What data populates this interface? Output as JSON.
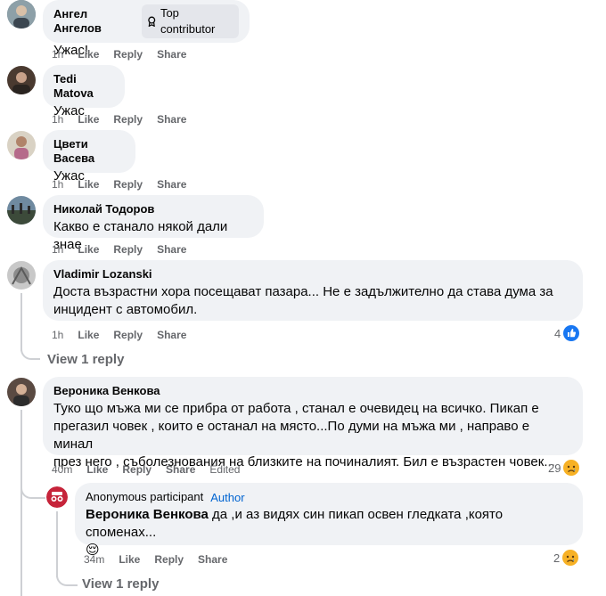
{
  "comments": [
    {
      "author": "Ангел Ангелов",
      "badge": "Top contributor",
      "text": "Ужас!",
      "time": "1h",
      "like": "Like",
      "reply": "Reply",
      "share": "Share"
    },
    {
      "author": "Tedi Matova",
      "text": "Ужас",
      "time": "1h",
      "like": "Like",
      "reply": "Reply",
      "share": "Share"
    },
    {
      "author": "Цвети Васева",
      "text": "Ужас",
      "time": "1h",
      "like": "Like",
      "reply": "Reply",
      "share": "Share"
    },
    {
      "author": "Николай Тодоров",
      "text": "Какво е станало някой дали знае",
      "time": "1h",
      "like": "Like",
      "reply": "Reply",
      "share": "Share"
    },
    {
      "author": "Vladimir Lozanski",
      "text_lines": [
        "Доста възрастни хора посещават пазара... Не е задължително да става дума за",
        "инцидент с автомобил."
      ],
      "time": "1h",
      "like": "Like",
      "reply": "Reply",
      "share": "Share",
      "reaction_count": "4",
      "reaction_icon": "like-icon",
      "view_replies": "View 1 reply"
    },
    {
      "author": "Вероника Венкова",
      "text_lines": [
        "Туко що мъжа ми се прибра от работа , станал е очевидец на всичко. Пикап е",
        "прегазил човек , които е останал на място...По думи на мъжа ми , направо е минал",
        "през него , съболезнования на близките на починалият. Бил е възрастен човек..."
      ],
      "time": "40m",
      "like": "Like",
      "reply": "Reply",
      "share": "Share",
      "edited": "Edited",
      "reaction_count": "29",
      "reaction_icon": "sad-icon"
    }
  ],
  "reply": {
    "author": "Anonymous participant",
    "author_tag": "Author",
    "mention": "Вероника Венкова",
    "text": " да ,и аз видях син пикап освен гледката ,която споменах...",
    "emoji": "😌",
    "time": "34m",
    "like": "Like",
    "reply": "Reply",
    "share": "Share",
    "reaction_count": "2",
    "reaction_icon": "sad-icon"
  },
  "view_replies_2": "View 1 reply",
  "colors": {
    "bubble": "#f0f2f5",
    "meta": "#65676b",
    "like_blue": "#1877f2",
    "sad_yellow": "#f7b125",
    "author_blue": "#0064d1"
  }
}
